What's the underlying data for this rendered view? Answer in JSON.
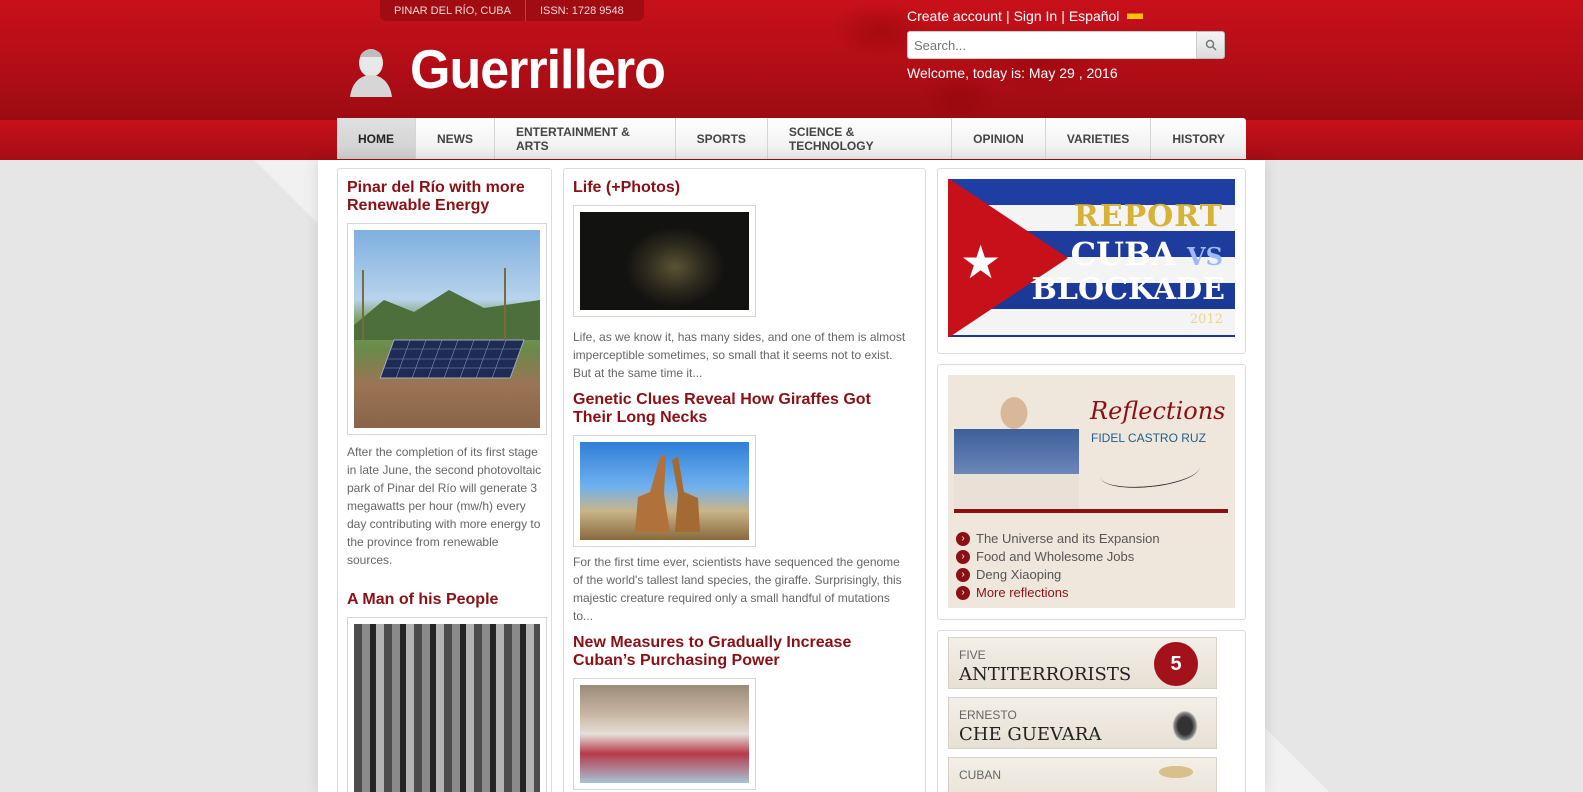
{
  "header": {
    "topbar": {
      "location": "PINAR DEL RÍO, CUBA",
      "issn": "ISSN: 1728 9548"
    },
    "brand": "Guerrillero",
    "account": {
      "create": "Create account",
      "separator1": "|",
      "signin": "Sign In",
      "separator2": "|",
      "language": "Español"
    },
    "search": {
      "placeholder": "Search..."
    },
    "welcome": "Welcome, today is: May 29 , 2016"
  },
  "nav": {
    "items": [
      {
        "label": "HOME"
      },
      {
        "label": "NEWS"
      },
      {
        "label": "ENTERTAINMENT & ARTS"
      },
      {
        "label": "SPORTS"
      },
      {
        "label": "SCIENCE & TECHNOLOGY"
      },
      {
        "label": "OPINION"
      },
      {
        "label": "VARIETIES"
      },
      {
        "label": "HISTORY"
      }
    ]
  },
  "col1": {
    "articles": [
      {
        "title": "Pinar del Río with more Renewable Energy",
        "summary": "After the completion of its first stage in late June, the second photovoltaic park of Pinar del Río will generate 3 megawatts per hour (mw/h) every day contributing with more energy to the province from renewable sources."
      },
      {
        "title": "A Man of his People"
      }
    ]
  },
  "col2": {
    "articles": [
      {
        "title": "Life (+Photos)",
        "summary": "Life, as we know it, has many sides, and one of them is almost imperceptible sometimes, so small that it seems not to exist. But at the same time it..."
      },
      {
        "title": "Genetic Clues Reveal How Giraffes Got Their Long Necks",
        "summary": "For the first time ever, scientists have sequenced the genome of the world's tallest land species, the giraffe. Surprisingly, this majestic creature required only a small handful of mutations to..."
      },
      {
        "title": "New Measures to Gradually Increase Cuban’s Purchasing Power"
      }
    ]
  },
  "sidebar": {
    "banner": {
      "line1": "REPORT",
      "line2a": "CUBA",
      "line2b": "VS",
      "line3": "BLOCKADE",
      "year": "2012"
    },
    "reflections": {
      "title": "Reflections",
      "author": "FIDEL CASTRO RUZ",
      "items": [
        "The Universe and its Expansion",
        "Food and Wholesome Jobs",
        "Deng Xiaoping"
      ],
      "more": "More reflections"
    },
    "five": {
      "small": "FIVE",
      "big": "ANTITERRORISTS",
      "badge": "5"
    },
    "che": {
      "small": "ERNESTO",
      "big": "CHE GUEVARA"
    },
    "cuban": {
      "small": "CUBAN"
    }
  },
  "colors": {
    "brand_red": "#c8101a",
    "title_red": "#8b1015"
  }
}
